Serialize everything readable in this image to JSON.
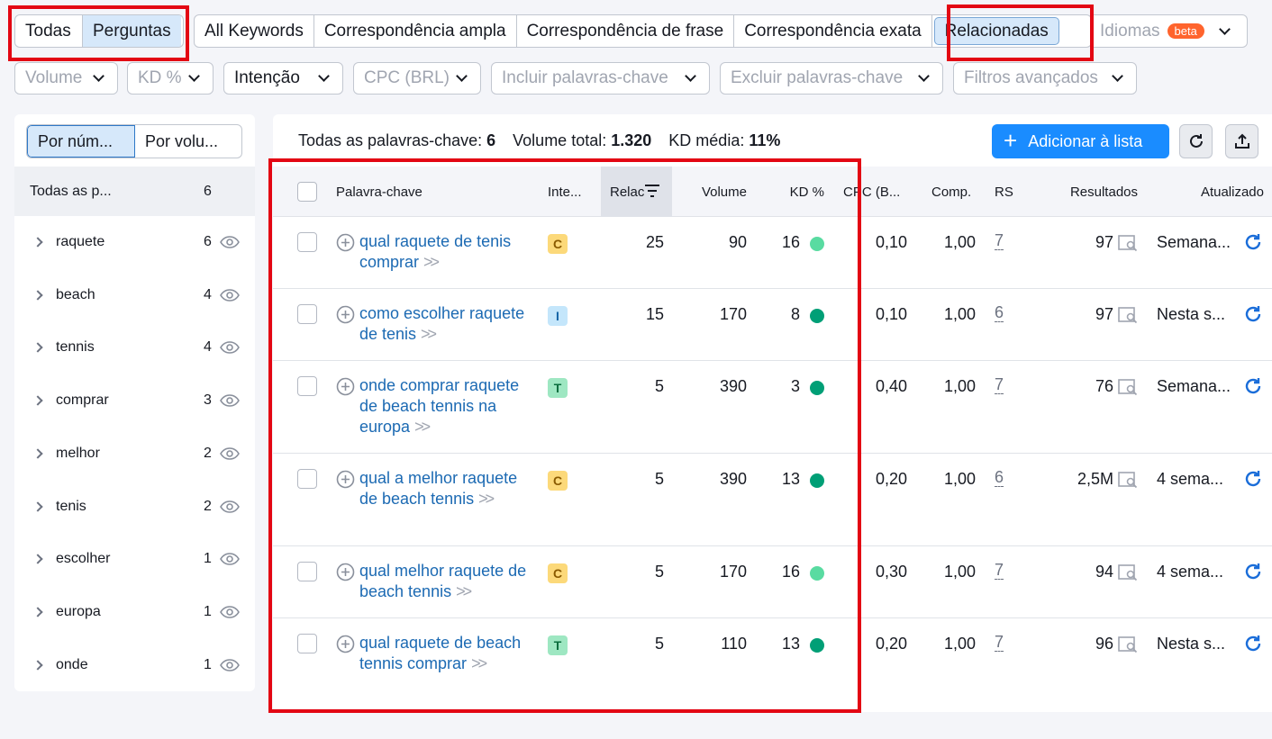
{
  "tabs_group1": [
    "Todas",
    "Perguntas"
  ],
  "tabs_group2": [
    "All Keywords",
    "Correspondência ampla",
    "Correspondência de frase",
    "Correspondência exata",
    "Relacionadas"
  ],
  "idiomas": {
    "label": "Idiomas",
    "badge": "beta"
  },
  "filters": [
    "Volume",
    "KD %",
    "Intenção",
    "CPC (BRL)",
    "Incluir palavras-chave",
    "Excluir palavras-chave",
    "Filtros avançados"
  ],
  "left_panel": {
    "sort_options": [
      "Por núm...",
      "Por volu..."
    ],
    "all_label": "Todas as p...",
    "all_count": "6",
    "groups": [
      {
        "name": "raquete",
        "count": "6"
      },
      {
        "name": "beach",
        "count": "4"
      },
      {
        "name": "tennis",
        "count": "4"
      },
      {
        "name": "comprar",
        "count": "3"
      },
      {
        "name": "melhor",
        "count": "2"
      },
      {
        "name": "tenis",
        "count": "2"
      },
      {
        "name": "escolher",
        "count": "1"
      },
      {
        "name": "europa",
        "count": "1"
      },
      {
        "name": "onde",
        "count": "1"
      }
    ]
  },
  "summary": {
    "all_label": "Todas as palavras-chave:",
    "all_value": "6",
    "volume_label": "Volume total:",
    "volume_value": "1.320",
    "kd_label": "KD média:",
    "kd_value": "11%"
  },
  "add_button": "Adicionar à lista",
  "columns": [
    "Palavra-chave",
    "Inte...",
    "Relac",
    "Volume",
    "KD %",
    "CPC (B...",
    "Comp.",
    "RS",
    "Resultados",
    "Atualizado"
  ],
  "rows": [
    {
      "keyword": "qual raquete de tenis comprar",
      "intent": "C",
      "related": "25",
      "volume": "90",
      "kd": "16",
      "kd_color": "#59dba1",
      "cpc": "0,10",
      "comp": "1,00",
      "rs": "7",
      "results": "97",
      "updated": "Semana..."
    },
    {
      "keyword": "como escolher raquete de tenis",
      "intent": "I",
      "related": "15",
      "volume": "170",
      "kd": "8",
      "kd_color": "#009f76",
      "cpc": "0,10",
      "comp": "1,00",
      "rs": "6",
      "results": "97",
      "updated": "Nesta s..."
    },
    {
      "keyword": "onde comprar raquete de beach tennis na europa",
      "intent": "T",
      "related": "5",
      "volume": "390",
      "kd": "3",
      "kd_color": "#009f76",
      "cpc": "0,40",
      "comp": "1,00",
      "rs": "7",
      "results": "76",
      "updated": "Semana..."
    },
    {
      "keyword": "qual a melhor raquete de beach tennis",
      "intent": "C",
      "related": "5",
      "volume": "390",
      "kd": "13",
      "kd_color": "#009f76",
      "cpc": "0,20",
      "comp": "1,00",
      "rs": "6",
      "results": "2,5M",
      "updated": "4 sema..."
    },
    {
      "keyword": "qual melhor raquete de beach tennis",
      "intent": "C",
      "related": "5",
      "volume": "170",
      "kd": "16",
      "kd_color": "#59dba1",
      "cpc": "0,30",
      "comp": "1,00",
      "rs": "7",
      "results": "94",
      "updated": "4 sema..."
    },
    {
      "keyword": "qual raquete de beach tennis comprar",
      "intent": "T",
      "related": "5",
      "volume": "110",
      "kd": "13",
      "kd_color": "#009f76",
      "cpc": "0,20",
      "comp": "1,00",
      "rs": "7",
      "results": "96",
      "updated": "Nesta s..."
    }
  ]
}
